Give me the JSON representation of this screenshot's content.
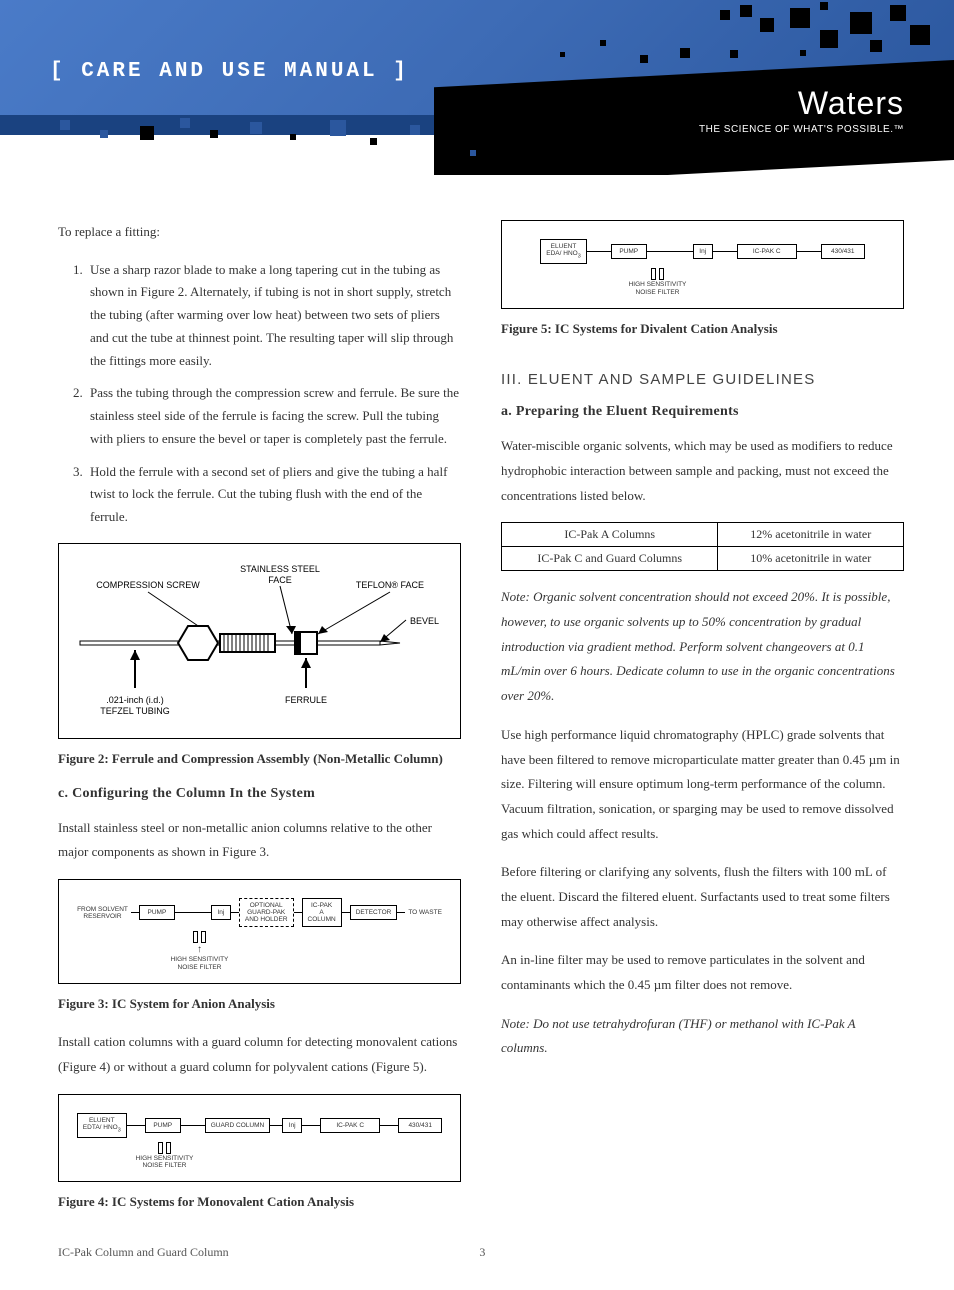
{
  "header": {
    "manual_title": "[ CARE AND USE MANUAL ]",
    "logo": "Waters",
    "tagline": "THE SCIENCE OF WHAT'S POSSIBLE.™"
  },
  "left": {
    "intro": "To replace a fitting:",
    "steps": [
      "Use a sharp razor blade to make a long tapering cut in the tubing as shown in Figure 2. Alternately, if tubing is not in short supply, stretch the tubing (after warming over low heat) between two sets of pliers and cut the tube at thinnest point. The resulting taper will slip through the fittings more easily.",
      "Pass the tubing through the compression screw and ferrule. Be sure the stainless steel side of the ferrule is facing the screw. Pull the tubing with pliers to ensure the bevel or taper is completely past the ferrule.",
      "Hold the ferrule with a second set of pliers and give the tubing a half twist to lock the ferrule. Cut the tubing flush with the end of the ferrule."
    ],
    "fig2": {
      "labels": {
        "compression_screw": "COMPRESSION SCREW",
        "stainless_face": "STAINLESS STEEL FACE",
        "teflon_face": "TEFLON® FACE",
        "bevel": "BEVEL",
        "tubing": ".021-inch (i.d.) TEFZEL TUBING",
        "ferrule": "FERRULE"
      },
      "caption": "Figure 2: Ferrule and Compression Assembly (Non-Metallic Column)"
    },
    "section_c_head": "c. Configuring the Column In the System",
    "section_c_p1": "Install stainless steel or non-metallic anion columns relative to the other major components as shown in Figure 3.",
    "fig3": {
      "left_label": "FROM SOLVENT RESERVOIR",
      "boxes": [
        "PUMP",
        "Inj",
        "OPTIONAL GUARD-PAK AND HOLDER",
        "IC-PAK A COLUMN",
        "DETECTOR"
      ],
      "right_label": "TO WASTE",
      "noise_filter": "HIGH SENSITIVITY NOISE FILTER",
      "caption": "Figure 3: IC System for Anion Analysis"
    },
    "section_c_p2": "Install cation columns with a guard column for detecting monovalent cations (Figure 4) or without a guard column for polyvalent cations (Figure 5).",
    "fig4": {
      "boxes": [
        "ELUENT EDTA/ HNO₃",
        "PUMP",
        "GUARD COLUMN",
        "Inj",
        "IC-PAK C",
        "430/431"
      ],
      "noise_filter": "HIGH SENSITIVITY NOISE FILTER",
      "caption": "Figure 4: IC Systems for Monovalent Cation Analysis"
    }
  },
  "right": {
    "fig5": {
      "boxes": [
        "ELUENT EDA/ HNO₃",
        "PUMP",
        "Inj",
        "IC-PAK C",
        "430/431"
      ],
      "noise_filter": "HIGH SENSITIVITY NOISE FILTER",
      "caption": "Figure 5: IC Systems for Divalent Cation Analysis"
    },
    "section_iii_head": "III. ELUENT AND SAMPLE GUIDELINES",
    "sub_a_head": "a. Preparing the Eluent Requirements",
    "p1": "Water-miscible organic solvents, which may be used as modifiers to reduce hydrophobic interaction between sample and packing, must not exceed the concentrations listed below.",
    "table": {
      "rows": [
        [
          "IC-Pak A Columns",
          "12% acetonitrile in water"
        ],
        [
          "IC-Pak C and Guard Columns",
          "10% acetonitrile in water"
        ]
      ]
    },
    "note1": "Note: Organic solvent concentration should not exceed 20%. It is possible, however, to use organic solvents up to 50% concentration by gradual introduction via gradient method. Perform solvent changeovers at 0.1 mL/min over 6 hours. Dedicate column to use in the organic concentrations over 20%.",
    "p2": "Use high performance liquid chromatography (HPLC) grade solvents that have been filtered to remove microparticulate matter greater than 0.45 µm in size. Filtering will ensure optimum long-term performance of the column. Vacuum filtration, sonication, or sparging may be used to remove dissolved gas which could affect results.",
    "p3": "Before filtering or clarifying any solvents, flush the filters with 100 mL of the eluent. Discard the filtered eluent. Surfactants used to treat some filters may otherwise affect analysis.",
    "p4": "An in-line filter may be used to remove particulates in the solvent and contaminants which the 0.45 µm filter does not remove.",
    "note2": "Note: Do not use tetrahydrofuran (THF) or methanol with IC-Pak A columns."
  },
  "footer": {
    "left": "IC-Pak Column and Guard Column",
    "page": "3"
  }
}
